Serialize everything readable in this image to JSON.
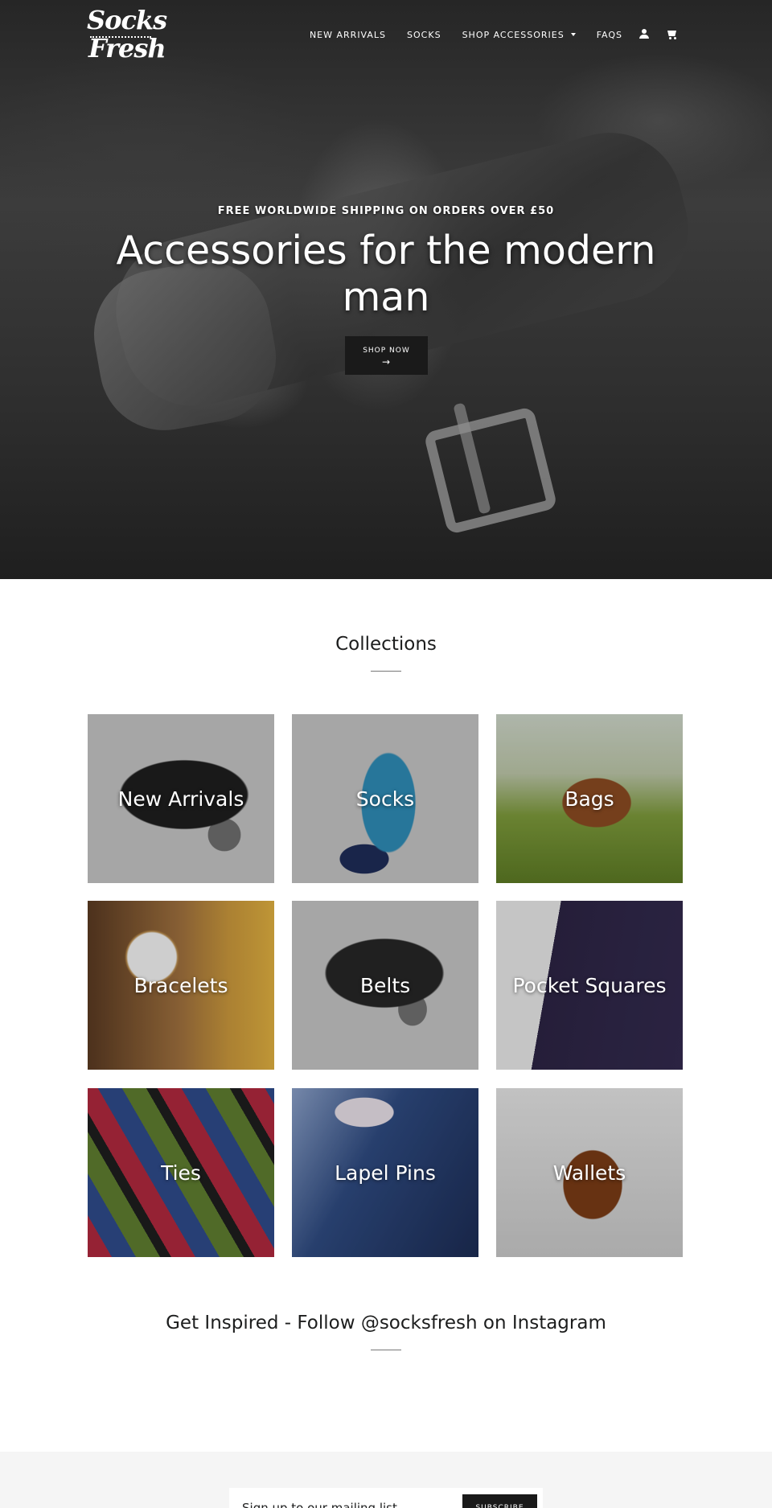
{
  "brand": {
    "logo_line1": "Socks",
    "logo_line2": "Fresh"
  },
  "nav": {
    "items": [
      "NEW ARRIVALS",
      "SOCKS",
      "SHOP ACCESSORIES",
      "FAQS"
    ],
    "icons": [
      "user-icon",
      "cart-icon"
    ]
  },
  "hero": {
    "subtitle": "FREE WORLDWIDE SHIPPING ON ORDERS OVER £50",
    "title": "Accessories for the modern man",
    "button_label": "SHOP NOW",
    "button_arrow": "→"
  },
  "collections": {
    "heading": "Collections",
    "items": [
      "New Arrivals",
      "Socks",
      "Bags",
      "Bracelets",
      "Belts",
      "Pocket Squares",
      "Ties",
      "Lapel Pins",
      "Wallets"
    ]
  },
  "instagram": {
    "heading": "Get Inspired - Follow @socksfresh on Instagram"
  },
  "newsletter": {
    "placeholder": "Sign up to our mailing list",
    "button_label": "SUBSCRIBE"
  }
}
